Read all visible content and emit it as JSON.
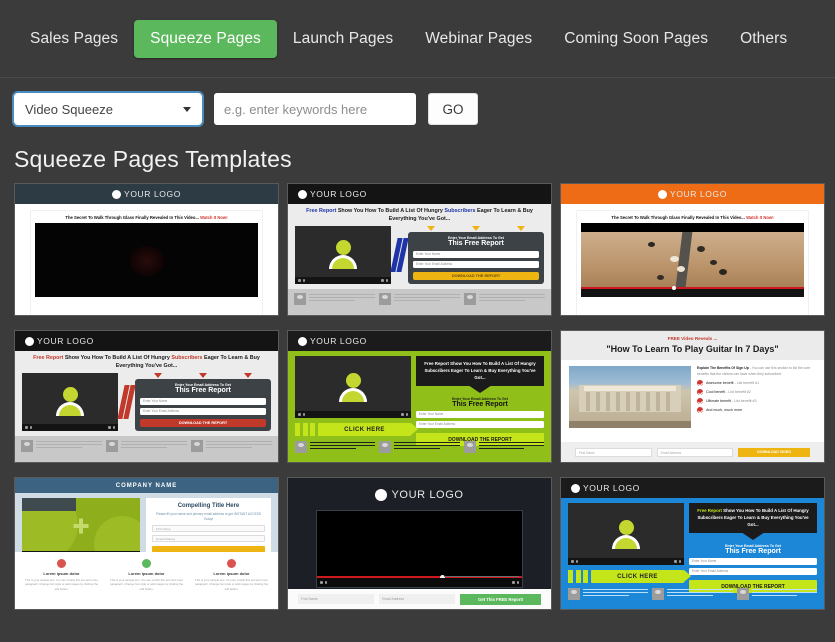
{
  "nav": {
    "tabs": [
      {
        "label": "Sales Pages",
        "active": false
      },
      {
        "label": "Squeeze Pages",
        "active": true
      },
      {
        "label": "Launch Pages",
        "active": false
      },
      {
        "label": "Webinar Pages",
        "active": false
      },
      {
        "label": "Coming Soon Pages",
        "active": false
      },
      {
        "label": "Others",
        "active": false
      }
    ],
    "active_color": "#5cb85c"
  },
  "filter": {
    "category_selected": "Video Squeeze",
    "caret_icon": "chevron-down-icon",
    "keywords_placeholder": "e.g. enter keywords here",
    "keywords_value": "",
    "go_label": "GO",
    "focus_ring_color": "#52a8ec"
  },
  "page": {
    "title": "Squeeze Pages Templates",
    "background": "#3b3b3b"
  },
  "common": {
    "logo_text": "YOUR LOGO",
    "logo_icon": "circle-logo-icon",
    "optin_small": "Enter Your Email Address To Get",
    "optin_big": "This Free Report",
    "field_name": "Enter Your Name",
    "field_email": "Enter Your Email Address",
    "download_btn": "DOWNLOAD THE REPORT",
    "click_here_btn": "CLICK HERE",
    "video_headline": "The Secret To Walk Through Glass Finally Revealed In This Video...",
    "video_headline_cta": "Watch It Now!",
    "free_report_lead": "Free Report",
    "free_report_rest": " Show You How To Build A List Of Hungry ",
    "free_report_bold": "Subscribers",
    "free_report_tail": " Eager To Learn & Buy Everything You've Got..."
  },
  "templates": [
    {
      "id": "tpl-1",
      "name": "video-squeeze-dark-header",
      "header_color": "#2c3b44",
      "headline": "The Secret To Walk Through Glass Finally Revealed In This Video...",
      "headline_cta": "Watch It Now!",
      "video_style": "black"
    },
    {
      "id": "tpl-2",
      "name": "free-report-blue-chevron",
      "header_color": "#1a1a1a",
      "headline_part1": "Free Report",
      "headline_part2": " Show You How To Build A List Of Hungry ",
      "headline_part3": "Subscribers",
      "headline_part4": " Eager To Learn & Buy Everything You've Got...",
      "accent": "#1d35a8",
      "arrow_color": "#edb412",
      "button_color": "#edb412",
      "button_label": "DOWNLOAD THE REPORT"
    },
    {
      "id": "tpl-3",
      "name": "video-squeeze-orange-header",
      "header_color": "#ef6c16",
      "headline": "The Secret To Walk Through Glass Finally Revealed In This Video...",
      "headline_cta": "Watch It Now!",
      "video_style": "desert-road"
    },
    {
      "id": "tpl-4",
      "name": "free-report-red-chevron",
      "header_color": "#1a1a1a",
      "headline_part1": "Free Report",
      "headline_part2": " Show You How To Build A List Of Hungry ",
      "headline_part3": "Subscribers",
      "headline_part4": " Eager To Learn & Buy Everything You've Got...",
      "accent": "#c0392b",
      "arrow_color": "#c0392b",
      "button_color": "#c0392b",
      "button_label": "DOWNLOAD THE REPORT"
    },
    {
      "id": "tpl-5",
      "name": "lime-click-here-squeeze",
      "background": "#8fbf18",
      "headline": "Free Report Show You How To Build A List Of Hungry Subscribers Eager To Learn & Buy Everything You've Got...",
      "click_label": "CLICK HERE",
      "download_label": "DOWNLOAD THE REPORT"
    },
    {
      "id": "tpl-6",
      "name": "guitar-video-squeeze",
      "pre_headline": "FREE Video Reveals ...",
      "headline": "\"How To Learn To Play Guitar In 7 Days\"",
      "benefits_intro_bold": "Explain The Benefits Of Sign Up",
      "benefits_intro": " - You can use this section to list the core benefits that the visitors can have when they subscribed.",
      "benefits": [
        {
          "bold": "Awesome benefit",
          "rest": " - List benefit #1"
        },
        {
          "bold": "Cool benefit",
          "rest": " - List benefit #2"
        },
        {
          "bold": "Ultimate benefit",
          "rest": " - List benefit #3"
        },
        {
          "bold": "And much, much more",
          "rest": ""
        }
      ],
      "field_first": "First Name",
      "field_email": "Email Address",
      "button_label": "DOWNLOAD VIDEO"
    },
    {
      "id": "tpl-7",
      "name": "company-name-lead-capture",
      "company_label": "COMPANY NAME",
      "title": "Compelling Title Here",
      "subtitle": "Please fill your name and primary email address to get INSTANT ACCESS Today!",
      "field_name": "First Name",
      "field_email": "Email Address",
      "features": [
        {
          "title": "Lorem ipsum dolor",
          "text": "This is your sample text. You can modify this text and more paragraph. Change font style or add images by clicking the edit button.",
          "color": "#d9534f"
        },
        {
          "title": "Lorem ipsum dolor",
          "text": "This is your sample text. You can modify this text and more paragraph. Change font style or add images by clicking the edit button.",
          "color": "#5cb85c"
        },
        {
          "title": "Lorem ipsum dolor",
          "text": "This is your sample text. You can modify this text and more paragraph. Change font style or add images by clicking the edit button.",
          "color": "#d9534f"
        }
      ]
    },
    {
      "id": "tpl-8",
      "name": "dark-video-squeeze",
      "background": "#1c2026",
      "field_first": "First Name",
      "field_email": "Email Address",
      "button_label": "Get This FREE Report!",
      "button_color": "#5cb85c"
    },
    {
      "id": "tpl-9",
      "name": "blue-click-here-squeeze",
      "background": "#1c87d6",
      "headline": "Free Report Show You How To Build A List Of Hungry Subscribers Eager To Learn & Buy Everything You've Got...",
      "click_label": "CLICK HERE",
      "download_label": "DOWNLOAD THE REPORT"
    }
  ]
}
